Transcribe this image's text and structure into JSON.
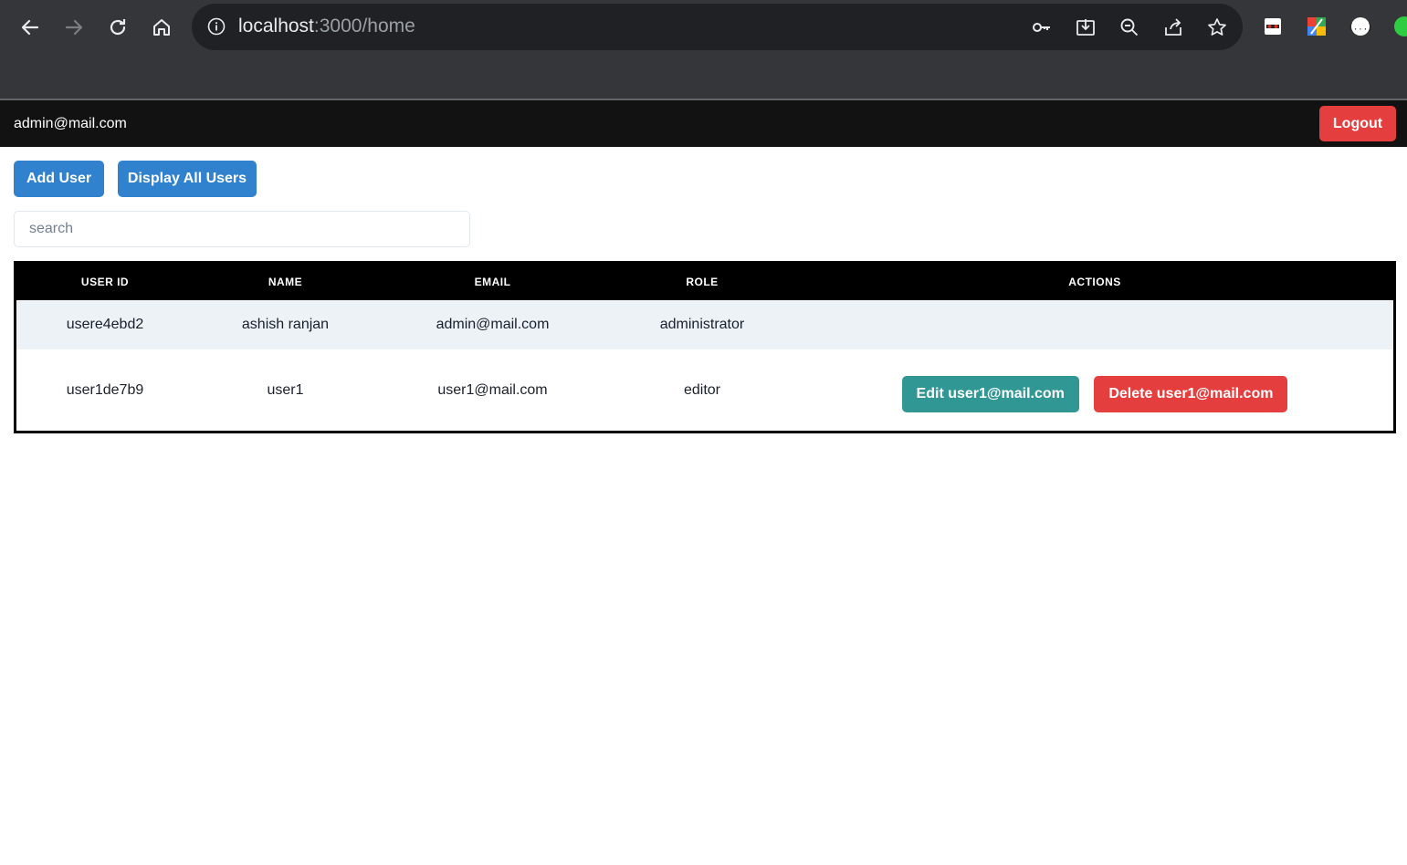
{
  "browser": {
    "url_host": "localhost",
    "url_path": ":3000/home"
  },
  "header": {
    "user_email": "admin@mail.com",
    "logout_label": "Logout"
  },
  "toolbar": {
    "add_user_label": "Add User",
    "display_all_label": "Display All Users",
    "search_placeholder": "search"
  },
  "table": {
    "columns": [
      "USER ID",
      "NAME",
      "EMAIL",
      "ROLE",
      "ACTIONS"
    ],
    "rows": [
      {
        "id": "usere4ebd2",
        "name": "ashish ranjan",
        "email": "admin@mail.com",
        "role": "administrator"
      },
      {
        "id": "user1de7b9",
        "name": "user1",
        "email": "user1@mail.com",
        "role": "editor",
        "edit_label": "Edit user1@mail.com",
        "delete_label": "Delete user1@mail.com"
      }
    ]
  },
  "colors": {
    "primary": "#3182ce",
    "danger": "#e53e3e",
    "teal": "#319795",
    "header_bg": "#121212"
  }
}
